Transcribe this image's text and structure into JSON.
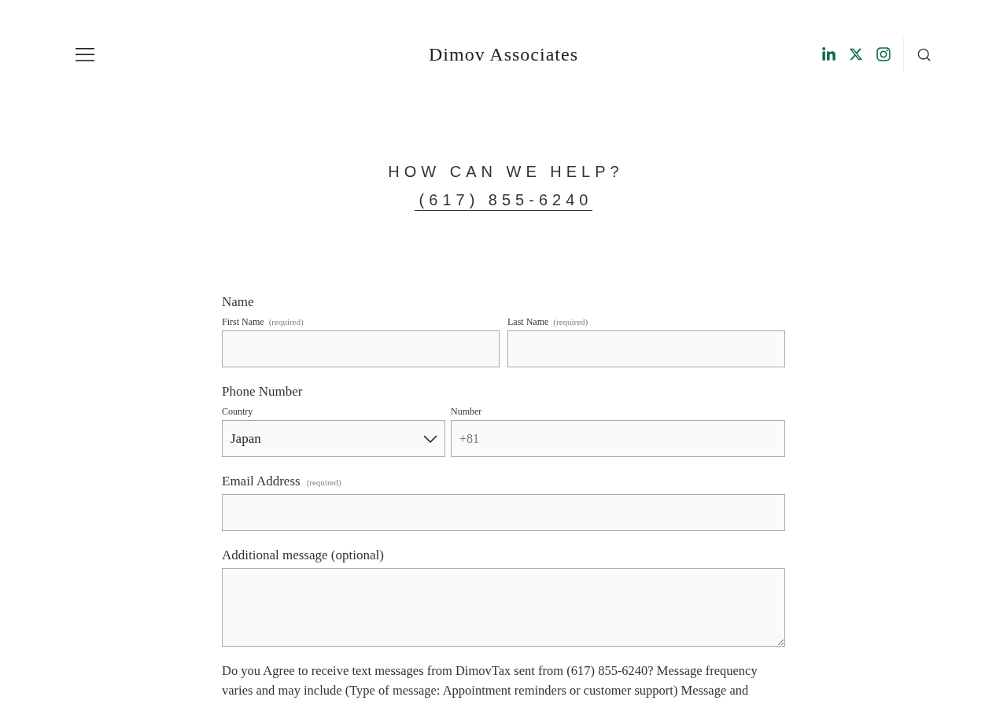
{
  "header": {
    "title": "Dimov Associates"
  },
  "hero": {
    "heading": "HOW CAN WE HELP?",
    "phone": "(617) 855-6240"
  },
  "form": {
    "name": {
      "label": "Name",
      "fields": [
        {
          "label": "First Name",
          "note": "(required)"
        },
        {
          "label": "Last Name",
          "note": "(required)"
        }
      ]
    },
    "phone": {
      "label": "Phone Number",
      "country": {
        "label": "Country",
        "value": "Japan"
      },
      "number": {
        "label": "Number",
        "placeholder": "+81"
      }
    },
    "email": {
      "label": "Email Address",
      "note": "(required)"
    },
    "message": {
      "label": "Additional message (optional)"
    },
    "consent": "Do you Agree to receive text messages from DimovTax sent from (617) 855-6240? Message frequency varies and may include (Type of message: Appointment reminders or customer support) Message and"
  }
}
